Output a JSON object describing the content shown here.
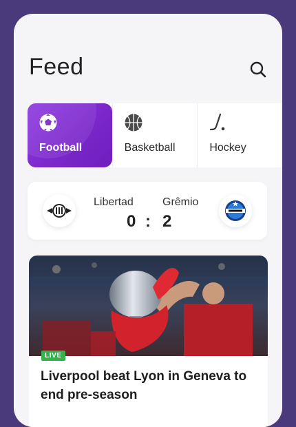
{
  "header": {
    "title": "Feed",
    "search_icon": "search-icon"
  },
  "tabs": [
    {
      "label": "Football",
      "icon": "football-icon",
      "active": true
    },
    {
      "label": "Basketball",
      "icon": "basketball-icon",
      "active": false
    },
    {
      "label": "Hockey",
      "icon": "hockey-icon",
      "active": false
    }
  ],
  "match": {
    "home_team": "Libertad",
    "away_team": "Grêmio",
    "home_score": "0",
    "separator": ":",
    "away_score": "2"
  },
  "news": {
    "badge": "LIVE",
    "headline": "Liverpool beat Lyon in Geneva to end pre-season"
  },
  "colors": {
    "background": "#4a3a7c",
    "accent": "#7a26c9",
    "live": "#35b34a"
  }
}
